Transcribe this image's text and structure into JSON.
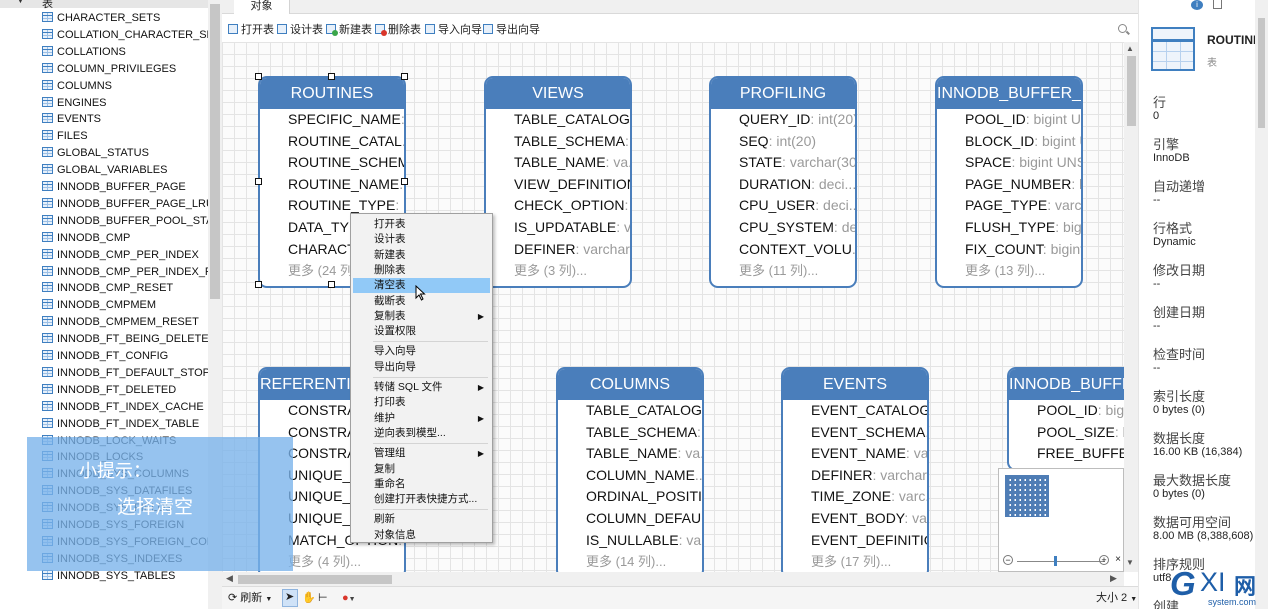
{
  "tree": {
    "root_label": "表",
    "items": [
      "CHARACTER_SETS",
      "COLLATION_CHARACTER_SET_APPLICABILITY",
      "COLLATIONS",
      "COLUMN_PRIVILEGES",
      "COLUMNS",
      "ENGINES",
      "EVENTS",
      "FILES",
      "GLOBAL_STATUS",
      "GLOBAL_VARIABLES",
      "INNODB_BUFFER_PAGE",
      "INNODB_BUFFER_PAGE_LRU",
      "INNODB_BUFFER_POOL_STATS",
      "INNODB_CMP",
      "INNODB_CMP_PER_INDEX",
      "INNODB_CMP_PER_INDEX_RESET",
      "INNODB_CMP_RESET",
      "INNODB_CMPMEM",
      "INNODB_CMPMEM_RESET",
      "INNODB_FT_BEING_DELETED",
      "INNODB_FT_CONFIG",
      "INNODB_FT_DEFAULT_STOPWORD",
      "INNODB_FT_DELETED",
      "INNODB_FT_INDEX_CACHE",
      "INNODB_FT_INDEX_TABLE",
      "INNODB_LOCK_WAITS",
      "INNODB_LOCKS",
      "INNODB_SYS_COLUMNS",
      "INNODB_SYS_DATAFILES",
      "INNODB_SYS_FIELDS",
      "INNODB_SYS_FOREIGN",
      "INNODB_SYS_FOREIGN_COLS",
      "INNODB_SYS_INDEXES",
      "INNODB_SYS_TABLES"
    ]
  },
  "tip": {
    "line1": "小提示：",
    "line2": "选择清空"
  },
  "tabs": {
    "objects": "对象"
  },
  "toolbar": {
    "open": "打开表",
    "design": "设计表",
    "new": "新建表",
    "delete": "删除表",
    "import": "导入向导",
    "export": "导出向导"
  },
  "entities": [
    {
      "title": "ROUTINES",
      "rows": [
        [
          "SPECIFIC_NAME",
          ": ..."
        ],
        [
          "ROUTINE_CATAL",
          "..."
        ],
        [
          "ROUTINE_SCHEMA",
          ""
        ],
        [
          "ROUTINE_NAME",
          "..."
        ],
        [
          "ROUTINE_TYPE",
          ": ..."
        ],
        [
          "DATA_TYPE",
          ""
        ],
        [
          "CHARACTE",
          ""
        ]
      ],
      "more": "更多 (24 列)..."
    },
    {
      "title": "VIEWS",
      "rows": [
        [
          "TABLE_CATALOG",
          "..."
        ],
        [
          "TABLE_SCHEMA",
          ": ..."
        ],
        [
          "TABLE_NAME",
          ": va..."
        ],
        [
          "VIEW_DEFINITION",
          "..."
        ],
        [
          "CHECK_OPTION",
          ": ..."
        ],
        [
          "IS_UPDATABLE",
          ": v..."
        ],
        [
          "DEFINER",
          ": varchar..."
        ]
      ],
      "more": "更多 (3 列)..."
    },
    {
      "title": "PROFILING",
      "rows": [
        [
          "QUERY_ID",
          ": int(20)"
        ],
        [
          "SEQ",
          ": int(20)"
        ],
        [
          "STATE",
          ": varchar(30)"
        ],
        [
          "DURATION",
          ": deci..."
        ],
        [
          "CPU_USER",
          ": deci..."
        ],
        [
          "CPU_SYSTEM",
          ": de..."
        ],
        [
          "CONTEXT_VOLU",
          "..."
        ]
      ],
      "more": "更多 (11 列)..."
    },
    {
      "title": "INNODB_BUFFER_PAGE",
      "rows": [
        [
          "POOL_ID",
          ": bigint UNSIG..."
        ],
        [
          "BLOCK_ID",
          ": bigint UNSIG..."
        ],
        [
          "SPACE",
          ": bigint UNSIGNED"
        ],
        [
          "PAGE_NUMBER",
          ": bigint ..."
        ],
        [
          "PAGE_TYPE",
          ": varchar(64)"
        ],
        [
          "FLUSH_TYPE",
          ": bigint UN..."
        ],
        [
          "FIX_COUNT",
          ": bigint UNS..."
        ]
      ],
      "more": "更多 (13 列)..."
    },
    {
      "title": "REFERENTIAL_CONSTRAINTS",
      "rows": [
        [
          "CONSTRAI",
          ""
        ],
        [
          "CONSTRAI",
          ""
        ],
        [
          "CONSTRAI",
          ""
        ],
        [
          "UNIQUE_C",
          ""
        ],
        [
          "UNIQUE_C",
          ""
        ],
        [
          "UNIQUE_C",
          ""
        ],
        [
          "MATCH_OPTION",
          ": varchar(64)"
        ]
      ],
      "more": "更多 (4 列)..."
    },
    {
      "title": "COLUMNS",
      "rows": [
        [
          "TABLE_CATALOG",
          "..."
        ],
        [
          "TABLE_SCHEMA",
          ": ..."
        ],
        [
          "TABLE_NAME",
          ": va..."
        ],
        [
          "COLUMN_NAME",
          "..."
        ],
        [
          "ORDINAL_POSITI",
          "..."
        ],
        [
          "COLUMN_DEFAULT",
          ""
        ],
        [
          "IS_NULLABLE",
          ": var..."
        ]
      ],
      "more": "更多 (14 列)..."
    },
    {
      "title": "EVENTS",
      "rows": [
        [
          "EVENT_CATALOG",
          "..."
        ],
        [
          "EVENT_SCHEMA",
          "..."
        ],
        [
          "EVENT_NAME",
          ": var..."
        ],
        [
          "DEFINER",
          ": varchar..."
        ],
        [
          "TIME_ZONE",
          ": varc..."
        ],
        [
          "EVENT_BODY",
          ": va..."
        ],
        [
          "EVENT_DEFINITION",
          ""
        ]
      ],
      "more": "更多 (17 列)..."
    },
    {
      "title": "INNODB_BUFFER_POOL_STATS",
      "rows": [
        [
          "POOL_ID",
          ": bigi"
        ],
        [
          "POOL_SIZE",
          ": big"
        ],
        [
          "FREE_BUFFERS",
          ""
        ]
      ],
      "more": ""
    }
  ],
  "context_menu": [
    {
      "label": "打开表"
    },
    {
      "label": "设计表"
    },
    {
      "label": "新建表"
    },
    {
      "label": "删除表"
    },
    {
      "label": "清空表",
      "highlight": true
    },
    {
      "label": "截断表"
    },
    {
      "label": "复制表",
      "submenu": true
    },
    {
      "label": "设置权限"
    },
    {
      "label": "导入向导"
    },
    {
      "label": "导出向导"
    },
    {
      "label": "转储 SQL 文件",
      "submenu": true
    },
    {
      "label": "打印表"
    },
    {
      "label": "维护",
      "submenu": true
    },
    {
      "label": "逆向表到模型..."
    },
    {
      "label": "管理组",
      "submenu": true
    },
    {
      "label": "复制"
    },
    {
      "label": "重命名"
    },
    {
      "label": "创建打开表快捷方式..."
    },
    {
      "label": "刷新"
    },
    {
      "label": "对象信息"
    }
  ],
  "status": {
    "refresh": "刷新",
    "size": "大小 2"
  },
  "right_panel": {
    "name": "ROUTINES",
    "type": "表",
    "props": [
      {
        "key": "行",
        "value": "0"
      },
      {
        "key": "引擎",
        "value": "InnoDB"
      },
      {
        "key": "自动递增",
        "value": "--"
      },
      {
        "key": "行格式",
        "value": "Dynamic"
      },
      {
        "key": "修改日期",
        "value": "--"
      },
      {
        "key": "创建日期",
        "value": "--"
      },
      {
        "key": "检查时间",
        "value": "--"
      },
      {
        "key": "索引长度",
        "value": "0 bytes (0)"
      },
      {
        "key": "数据长度",
        "value": "16.00 KB (16,384)"
      },
      {
        "key": "最大数据长度",
        "value": "0 bytes (0)"
      },
      {
        "key": "数据可用空间",
        "value": "8.00 MB (8,388,608)"
      },
      {
        "key": "排序规则",
        "value": "utf8"
      },
      {
        "key": "创建",
        "value": ""
      }
    ]
  },
  "watermark": {
    "g": "G",
    "xi": "XI",
    "wang": "网",
    "domain": "system.com"
  }
}
